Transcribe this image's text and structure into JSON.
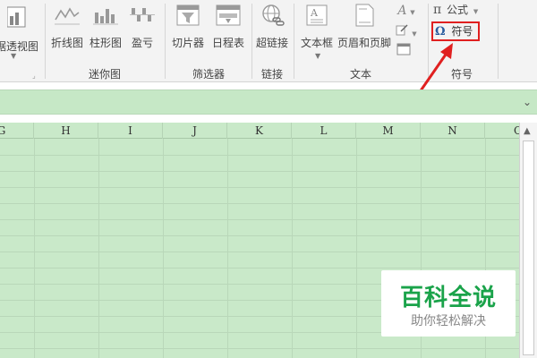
{
  "ribbon": {
    "pivot_partial": "据透视图",
    "sparklines": {
      "line": "折线图",
      "column": "柱形图",
      "winloss": "盈亏",
      "group": "迷你图"
    },
    "filters": {
      "slicer": "切片器",
      "timeline": "日程表",
      "group": "筛选器"
    },
    "links": {
      "hyperlink": "超链接",
      "group": "链接"
    },
    "text": {
      "textbox": "文本框",
      "header_footer": "页眉和页脚",
      "group": "文本"
    },
    "symbols": {
      "equation": "公式",
      "equation_glyph": "π",
      "symbol": "符号",
      "symbol_glyph": "Ω",
      "group": "符号"
    }
  },
  "formula_bar": {
    "expand_glyph": "⌄"
  },
  "grid": {
    "columns": [
      "G",
      "H",
      "I",
      "J",
      "K",
      "L",
      "M",
      "N",
      "O"
    ]
  },
  "watermark": {
    "main": "百科全说",
    "sub": "助你轻松解决"
  },
  "colors": {
    "sheet_bg": "#c9e9c9",
    "highlight": "#e02020",
    "watermark": "#1aa34a"
  }
}
